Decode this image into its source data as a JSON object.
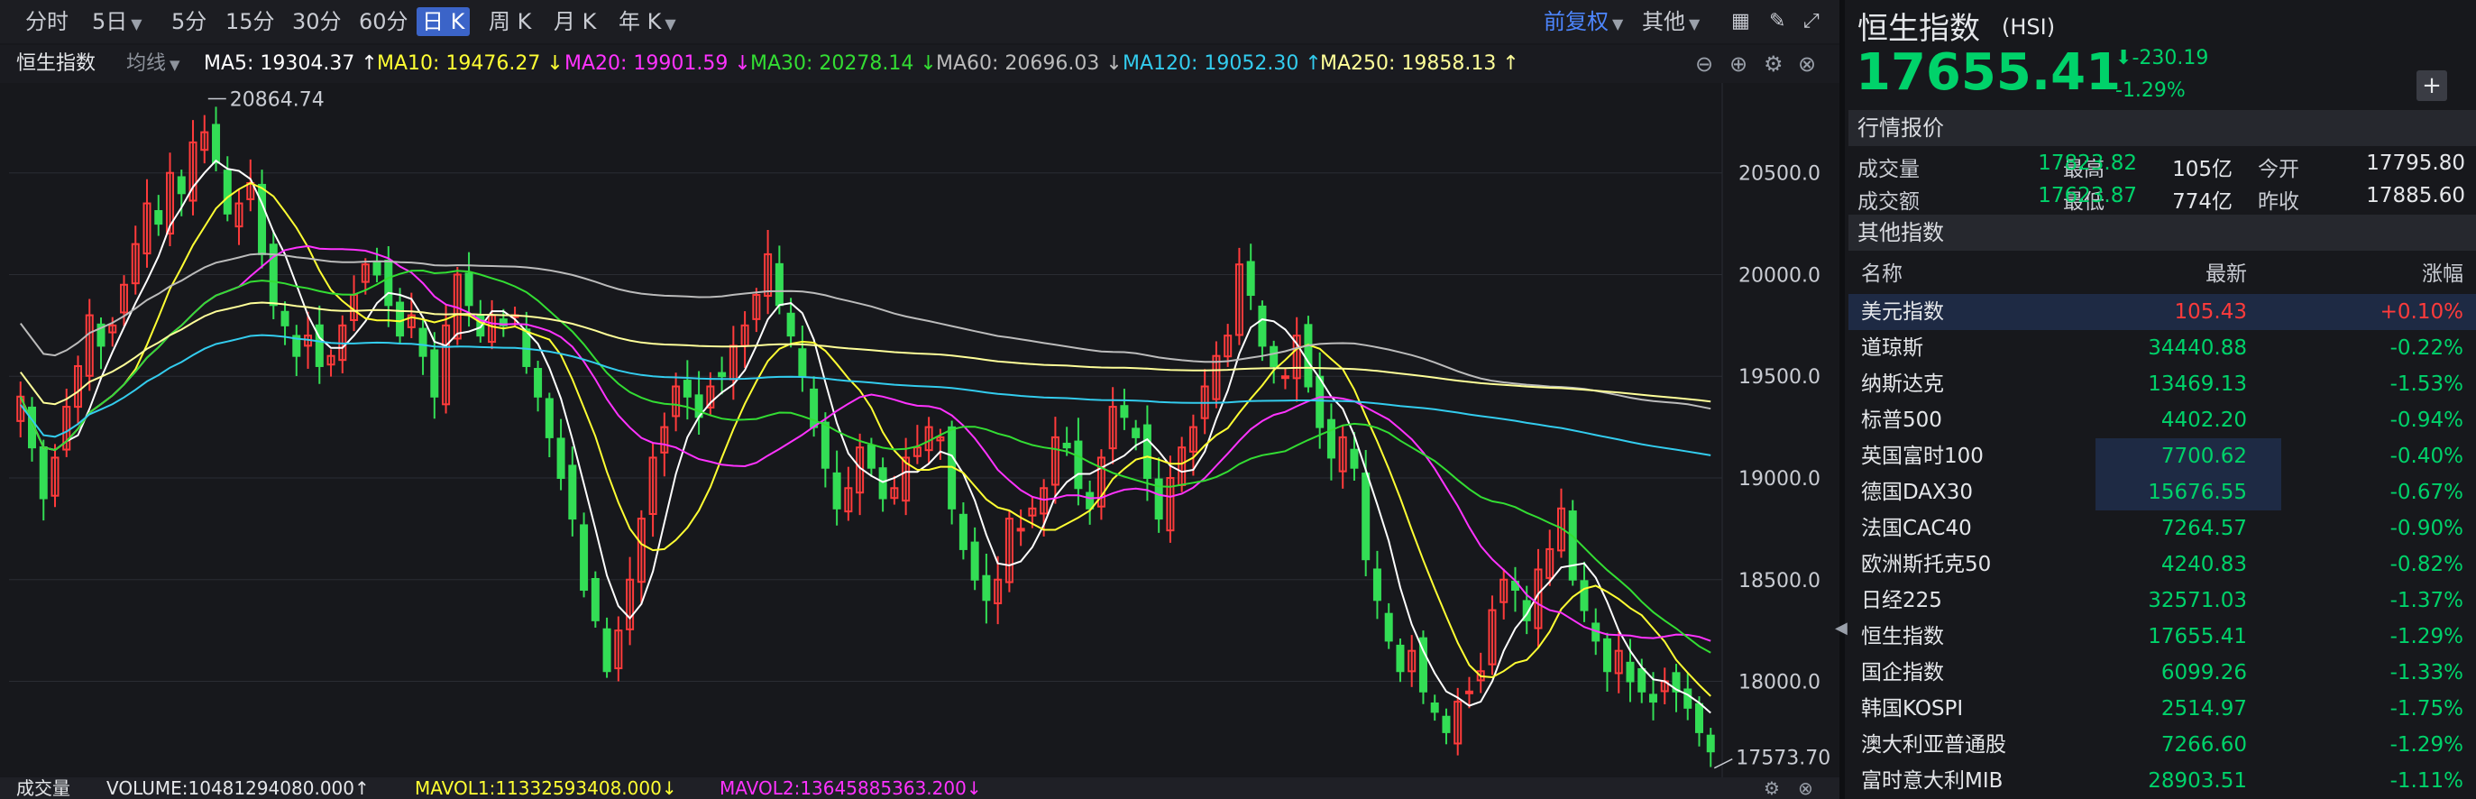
{
  "toolbar": {
    "periods": [
      {
        "label": "分时",
        "caret": false,
        "active": false
      },
      {
        "label": "5日",
        "caret": true,
        "active": false
      },
      {
        "label": "5分",
        "caret": false,
        "active": false
      },
      {
        "label": "15分",
        "caret": false,
        "active": false
      },
      {
        "label": "30分",
        "caret": false,
        "active": false
      },
      {
        "label": "60分",
        "caret": false,
        "active": false
      },
      {
        "label": "日 K",
        "caret": false,
        "active": true
      },
      {
        "label": "周 K",
        "caret": false,
        "active": false
      },
      {
        "label": "月 K",
        "caret": false,
        "active": false
      },
      {
        "label": "年 K",
        "caret": true,
        "active": false
      }
    ],
    "adjust_label": "前复权",
    "other_label": "其他"
  },
  "ma_bar": {
    "name": "恒生指数",
    "mode": "均线",
    "items": [
      {
        "text": "MA5: 19304.37 ↑",
        "color": "#ffffff"
      },
      {
        "text": "MA10: 19476.27 ↓",
        "color": "#ffff33"
      },
      {
        "text": "MA20: 19901.59 ↓",
        "color": "#ff33ff"
      },
      {
        "text": "MA30: 20278.14 ↓",
        "color": "#33dd33"
      },
      {
        "text": "MA60: 20696.03 ↓",
        "color": "#bbbbbb"
      },
      {
        "text": "MA120: 19052.30 ↑",
        "color": "#33ccee"
      },
      {
        "text": "MA250: 19858.13 ↑",
        "color": "#ffff99"
      }
    ]
  },
  "chart_data": {
    "type": "candlestick",
    "y_ticks": [
      20500,
      20000,
      19500,
      19000,
      18500,
      18000
    ],
    "y_tick_labels": [
      "20500.0",
      "20000.0",
      "19500.0",
      "19000.0",
      "18500.0",
      "18000.0"
    ],
    "ylim": [
      17550,
      20920
    ],
    "high_label": "20864.74",
    "low_label": "17573.70",
    "up_color": "#ff3b3b",
    "down_color": "#33dd55",
    "closes": [
      19400,
      19150,
      18900,
      19100,
      19350,
      19550,
      19800,
      19650,
      19750,
      19950,
      20150,
      20350,
      20250,
      20500,
      20400,
      20650,
      20700,
      20550,
      20300,
      20350,
      20450,
      20100,
      19850,
      19750,
      19600,
      19700,
      19550,
      19600,
      19750,
      19900,
      20050,
      20000,
      19850,
      19700,
      19800,
      19600,
      19400,
      19750,
      20000,
      19850,
      19700,
      19800,
      19750,
      19800,
      19550,
      19400,
      19200,
      19000,
      18800,
      18450,
      18300,
      18050,
      18250,
      18500,
      18800,
      19100,
      19250,
      19450,
      19400,
      19300,
      19450,
      19500,
      19650,
      19750,
      19900,
      20100,
      19850,
      19700,
      19500,
      19250,
      19050,
      18850,
      18950,
      19150,
      19050,
      18900,
      18950,
      19100,
      19150,
      19250,
      19200,
      18850,
      18650,
      18500,
      18400,
      18500,
      18800,
      18750,
      18850,
      18950,
      19200,
      19150,
      18950,
      18850,
      19100,
      19350,
      19300,
      19200,
      19000,
      18800,
      19000,
      19150,
      19250,
      19450,
      19600,
      19700,
      20050,
      19900,
      19650,
      19550,
      19500,
      19700,
      19450,
      19250,
      19100,
      19200,
      19050,
      18600,
      18400,
      18200,
      18050,
      18150,
      17950,
      17850,
      17750,
      17900,
      17950,
      18050,
      18350,
      18500,
      18450,
      18300,
      18550,
      18650,
      18850,
      18500,
      18350,
      18200,
      18050,
      18150,
      18000,
      17950,
      17900,
      18000,
      17950,
      17870,
      17750,
      17655.41
    ]
  },
  "volume_bar": {
    "label": "成交量",
    "volume": "VOLUME:10481294080.000↑",
    "mavol1": "MAVOL1:11332593408.000↓",
    "mavol2": "MAVOL2:13645885363.200↓"
  },
  "panel": {
    "title": "恒生指数",
    "code": "(HSI)",
    "price": "17655.41",
    "change": "-230.19",
    "change_pct": "-1.29%",
    "quote_head": "行情报价",
    "quote": [
      {
        "l1": "成交量",
        "v1": "105亿",
        "l2": "最高",
        "v2": "17823.82",
        "l3": "今开",
        "v3": "17795.80"
      },
      {
        "l1": "成交额",
        "v1": "774亿",
        "l2": "最低",
        "v2": "17623.87",
        "l3": "昨收",
        "v3": "17885.60"
      }
    ],
    "others_head": "其他指数",
    "cols": [
      "名称",
      "最新",
      "涨幅"
    ],
    "indices": [
      {
        "name": "美元指数",
        "last": "105.43",
        "pct": "+0.10%",
        "up": true
      },
      {
        "name": "道琼斯",
        "last": "34440.88",
        "pct": "-0.22%",
        "up": false
      },
      {
        "name": "纳斯达克",
        "last": "13469.13",
        "pct": "-1.53%",
        "up": false
      },
      {
        "name": "标普500",
        "last": "4402.20",
        "pct": "-0.94%",
        "up": false
      },
      {
        "name": "英国富时100",
        "last": "7700.62",
        "pct": "-0.40%",
        "up": false
      },
      {
        "name": "德国DAX30",
        "last": "15676.55",
        "pct": "-0.67%",
        "up": false
      },
      {
        "name": "法国CAC40",
        "last": "7264.57",
        "pct": "-0.90%",
        "up": false
      },
      {
        "name": "欧洲斯托克50",
        "last": "4240.83",
        "pct": "-0.82%",
        "up": false
      },
      {
        "name": "日经225",
        "last": "32571.03",
        "pct": "-1.37%",
        "up": false
      },
      {
        "name": "恒生指数",
        "last": "17655.41",
        "pct": "-1.29%",
        "up": false
      },
      {
        "name": "国企指数",
        "last": "6099.26",
        "pct": "-1.33%",
        "up": false
      },
      {
        "name": "韩国KOSPI",
        "last": "2514.97",
        "pct": "-1.75%",
        "up": false
      },
      {
        "name": "澳大利亚普通股",
        "last": "7266.60",
        "pct": "-1.29%",
        "up": false
      },
      {
        "name": "富时意大利MIB",
        "last": "28903.51",
        "pct": "-1.11%",
        "up": false
      }
    ]
  }
}
